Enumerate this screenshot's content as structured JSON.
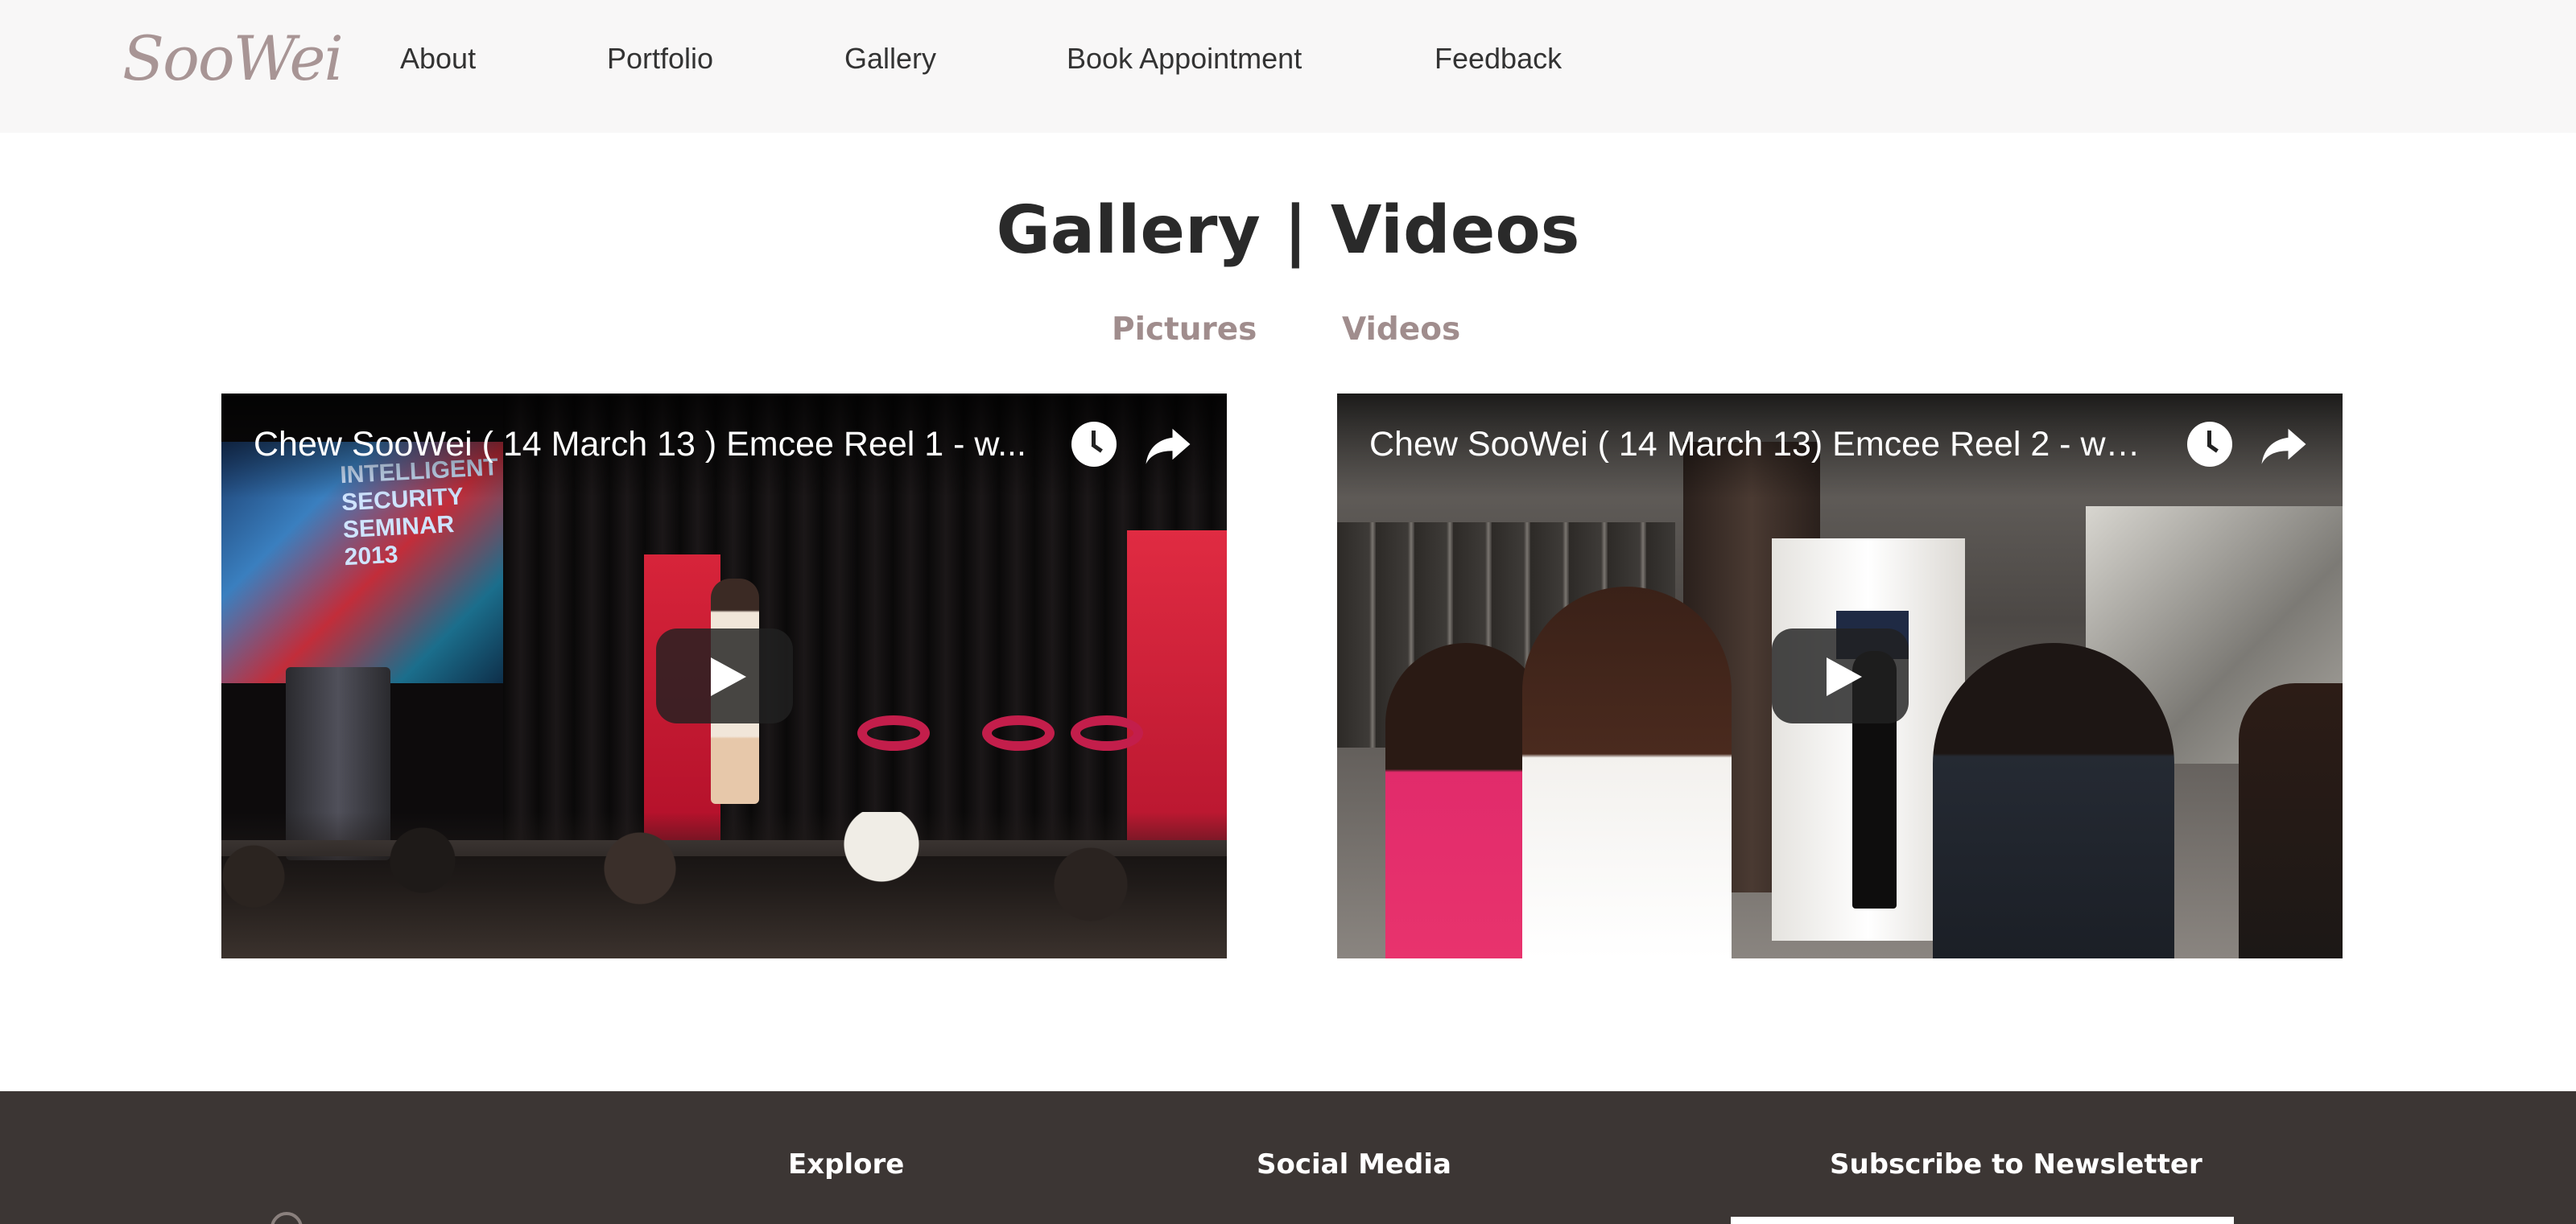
{
  "header": {
    "logo_text": "SooWei",
    "nav": [
      {
        "label": "About"
      },
      {
        "label": "Portfolio"
      },
      {
        "label": "Gallery"
      },
      {
        "label": "Book Appointment"
      },
      {
        "label": "Feedback"
      }
    ]
  },
  "main": {
    "title": "Gallery | Videos",
    "tabs": [
      {
        "label": "Pictures"
      },
      {
        "label": "Videos"
      }
    ],
    "videos": [
      {
        "title": "Chew SooWei ( 14 March 13 ) Emcee Reel 1 - w...",
        "screen_text": "INTELLIGENT SECURITY SEMINAR 2013"
      },
      {
        "title": "Chew SooWei ( 14 March 13) Emcee Reel 2 - ww..."
      }
    ]
  },
  "footer": {
    "headings": [
      {
        "label": "Explore"
      },
      {
        "label": "Social Media"
      },
      {
        "label": "Subscribe to Newsletter"
      }
    ]
  },
  "colors": {
    "header_bg": "#f8f7f7",
    "tab_accent": "#a08d8d",
    "footer_bg": "#3c3634",
    "logo": "#a89595"
  }
}
